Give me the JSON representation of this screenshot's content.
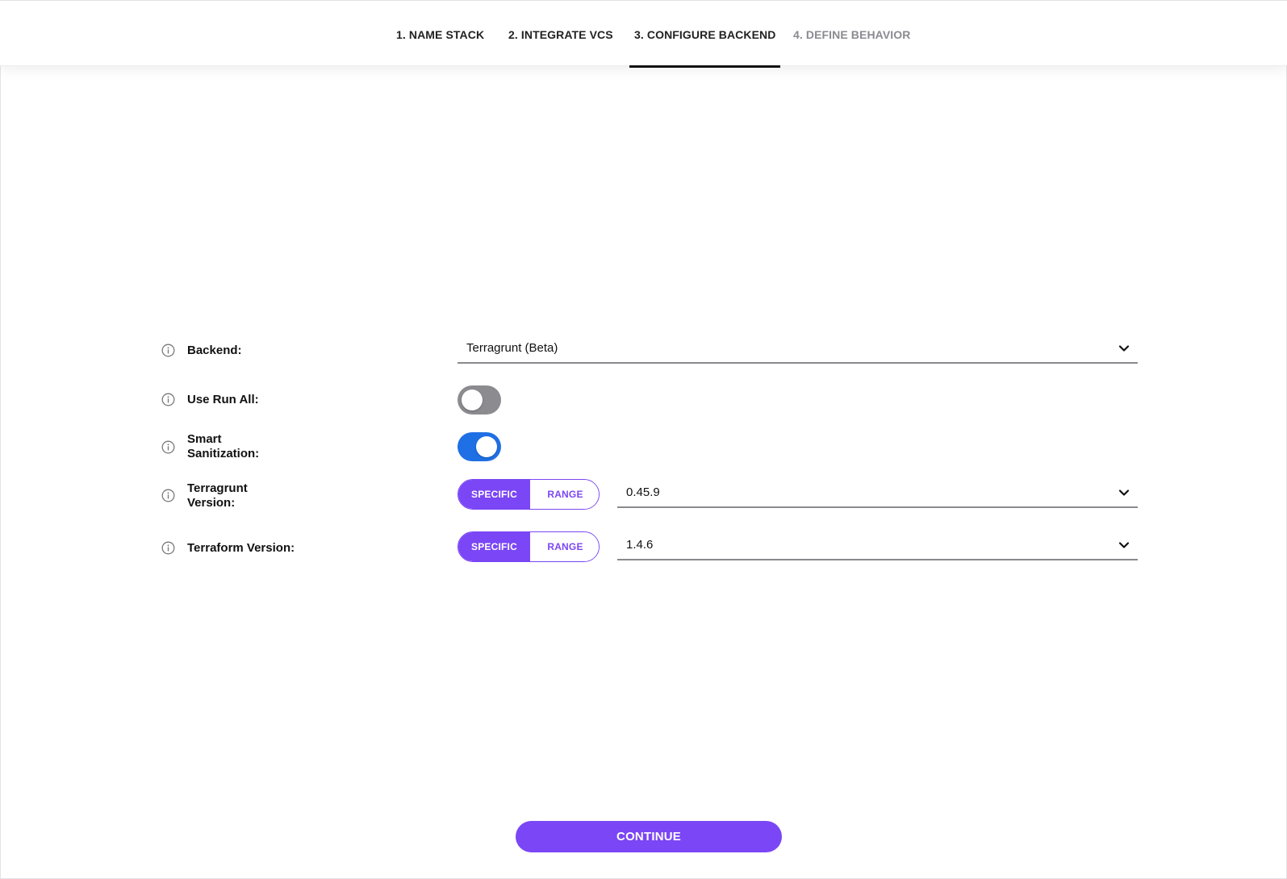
{
  "stepper": {
    "steps": [
      {
        "label": "1. NAME STACK",
        "state": "done"
      },
      {
        "label": "2. INTEGRATE VCS",
        "state": "done"
      },
      {
        "label": "3. CONFIGURE BACKEND",
        "state": "active"
      },
      {
        "label": "4. DEFINE BEHAVIOR",
        "state": "disabled"
      }
    ]
  },
  "form": {
    "backend": {
      "label": "Backend:",
      "value": "Terragrunt (Beta)"
    },
    "run_all": {
      "label": "Use Run All:",
      "checked": false
    },
    "smart_sanitization": {
      "label_line1": "Smart",
      "label_line2": "Sanitization:",
      "checked": true
    },
    "terragrunt_version": {
      "label_line1": "Terragrunt",
      "label_line2": "Version:",
      "mode_specific": "SPECIFIC",
      "mode_range": "RANGE",
      "selected_mode": "SPECIFIC",
      "value": "0.45.9"
    },
    "terraform_version": {
      "label": "Terraform Version:",
      "mode_specific": "SPECIFIC",
      "mode_range": "RANGE",
      "selected_mode": "SPECIFIC",
      "value": "1.4.6"
    }
  },
  "continue_label": "CONTINUE",
  "colors": {
    "accent": "#7b46f5",
    "toggle_on": "#1f6fe5",
    "toggle_off": "#8b8b90"
  },
  "icons": {
    "info": "info-circle-icon",
    "dropdown": "chevron-down-icon"
  }
}
